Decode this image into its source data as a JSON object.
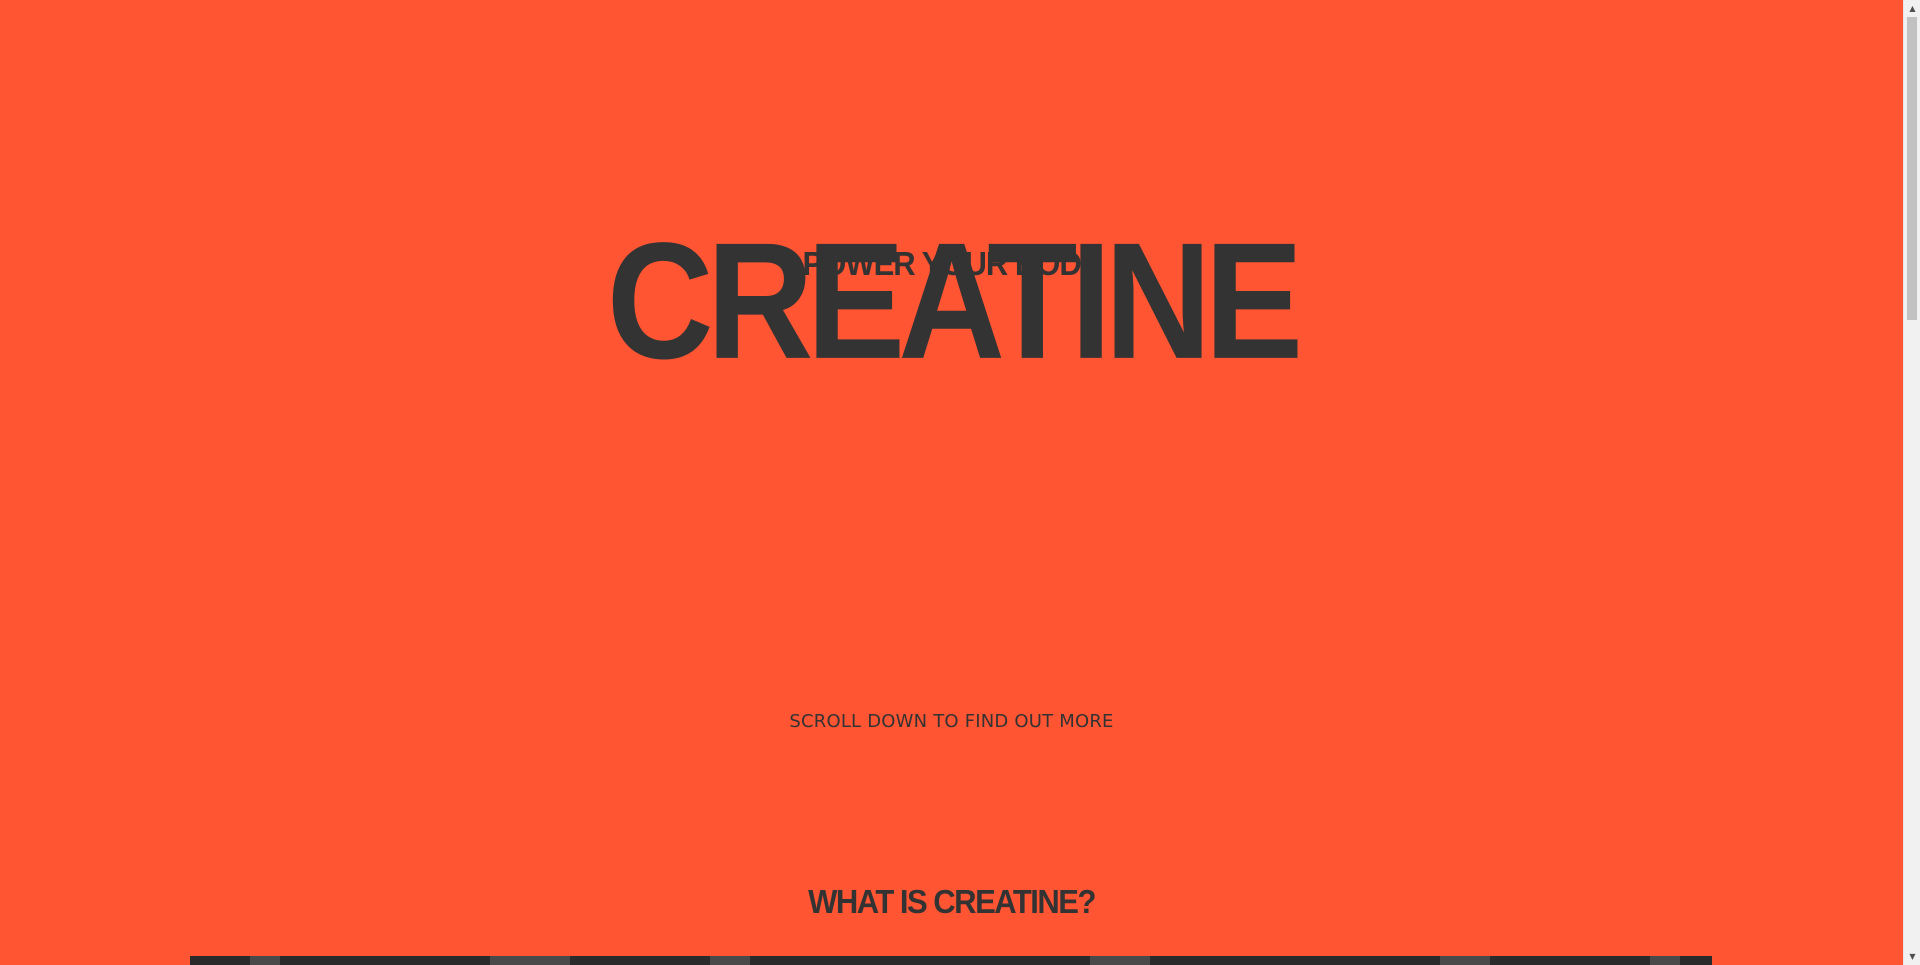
{
  "hero": {
    "title": "CREATINE",
    "subtitle": "POWER YOUR BODY"
  },
  "scroll_hint": "SCROLL DOWN TO FIND OUT MORE",
  "sections": {
    "what_is": {
      "title": "WHAT IS CREATINE?"
    }
  },
  "scrollbar": {
    "up_icon": "▲",
    "down_icon": "▼"
  },
  "colors": {
    "background": "#ff5533",
    "text": "#333333"
  }
}
